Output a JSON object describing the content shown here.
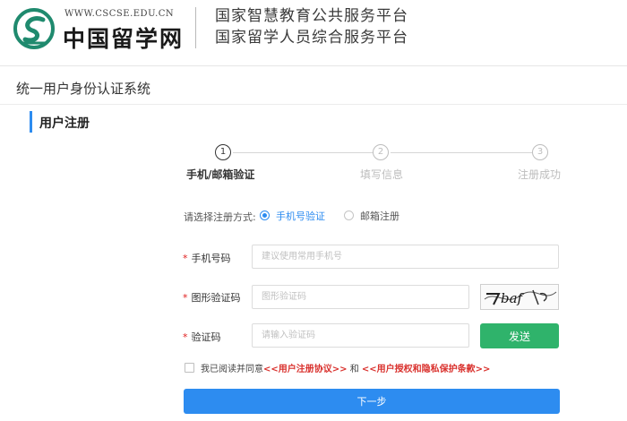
{
  "header": {
    "logo_url": "WWW.CSCSE.EDU.CN",
    "logo_text": "中国留学网",
    "platform_line1": "国家智慧教育公共服务平台",
    "platform_line2": "国家留学人员综合服务平台"
  },
  "system_title": "统一用户身份认证系统",
  "page_title": "用户注册",
  "steps": [
    {
      "num": "1",
      "label": "手机/邮箱验证",
      "active": true
    },
    {
      "num": "2",
      "label": "填写信息",
      "active": false
    },
    {
      "num": "3",
      "label": "注册成功",
      "active": false
    }
  ],
  "method": {
    "label": "请选择注册方式:",
    "options": [
      "手机号验证",
      "邮箱注册"
    ],
    "selected": "手机号验证"
  },
  "form": {
    "required_mark": "*",
    "phone": {
      "label": "手机号码",
      "placeholder": "建议使用常用手机号"
    },
    "captcha": {
      "label": "图形验证码",
      "placeholder": "图形验证码",
      "image_text": "baf"
    },
    "code": {
      "label": "验证码",
      "placeholder": "请输入验证码",
      "button": "发送"
    }
  },
  "agreement": {
    "prefix": "我已阅读并同意",
    "link1": "<<用户注册协议>>",
    "and": " 和 ",
    "link2": "<<用户授权和隐私保护条款>>"
  },
  "next_button": "下一步",
  "colors": {
    "primary": "#2d8cf0",
    "send": "#2fb36b",
    "required": "#e02020",
    "link": "#d9302c"
  }
}
